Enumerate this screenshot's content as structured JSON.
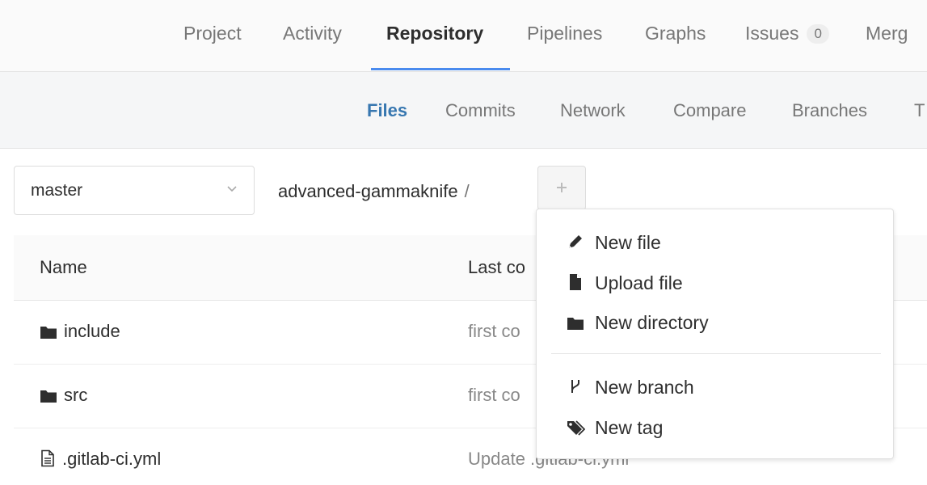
{
  "top_nav": {
    "tabs": [
      {
        "label": "Project"
      },
      {
        "label": "Activity"
      },
      {
        "label": "Repository",
        "active": true
      },
      {
        "label": "Pipelines"
      },
      {
        "label": "Graphs"
      },
      {
        "label": "Issues",
        "badge": "0"
      },
      {
        "label": "Merg"
      }
    ]
  },
  "sub_nav": {
    "tabs": [
      {
        "label": "Files",
        "active": true
      },
      {
        "label": "Commits"
      },
      {
        "label": "Network"
      },
      {
        "label": "Compare"
      },
      {
        "label": "Branches"
      },
      {
        "label": "T"
      }
    ]
  },
  "branch_selector": {
    "value": "master",
    "icon": "chevron-down-icon"
  },
  "breadcrumb": {
    "path": "advanced-gammaknife",
    "separator": "/"
  },
  "add_button": {
    "icon": "plus-icon"
  },
  "file_table": {
    "columns": [
      "Name",
      "Last co"
    ],
    "rows": [
      {
        "name": "include",
        "type": "folder",
        "last_commit": "first co"
      },
      {
        "name": "src",
        "type": "folder",
        "last_commit": "first co"
      },
      {
        "name": ".gitlab-ci.yml",
        "type": "file",
        "last_commit": "Update .gitlab-ci.yml"
      }
    ]
  },
  "dropdown": {
    "items": [
      {
        "label": "New file",
        "icon": "pencil-icon"
      },
      {
        "label": "Upload file",
        "icon": "file-icon"
      },
      {
        "label": "New directory",
        "icon": "folder-icon"
      },
      {
        "label": "New branch",
        "icon": "code-fork-icon"
      },
      {
        "label": "New tag",
        "icon": "tags-icon"
      }
    ]
  },
  "colors": {
    "accent": "#4a8bee",
    "active_subtab": "#3777b0",
    "muted_text": "#777777"
  }
}
